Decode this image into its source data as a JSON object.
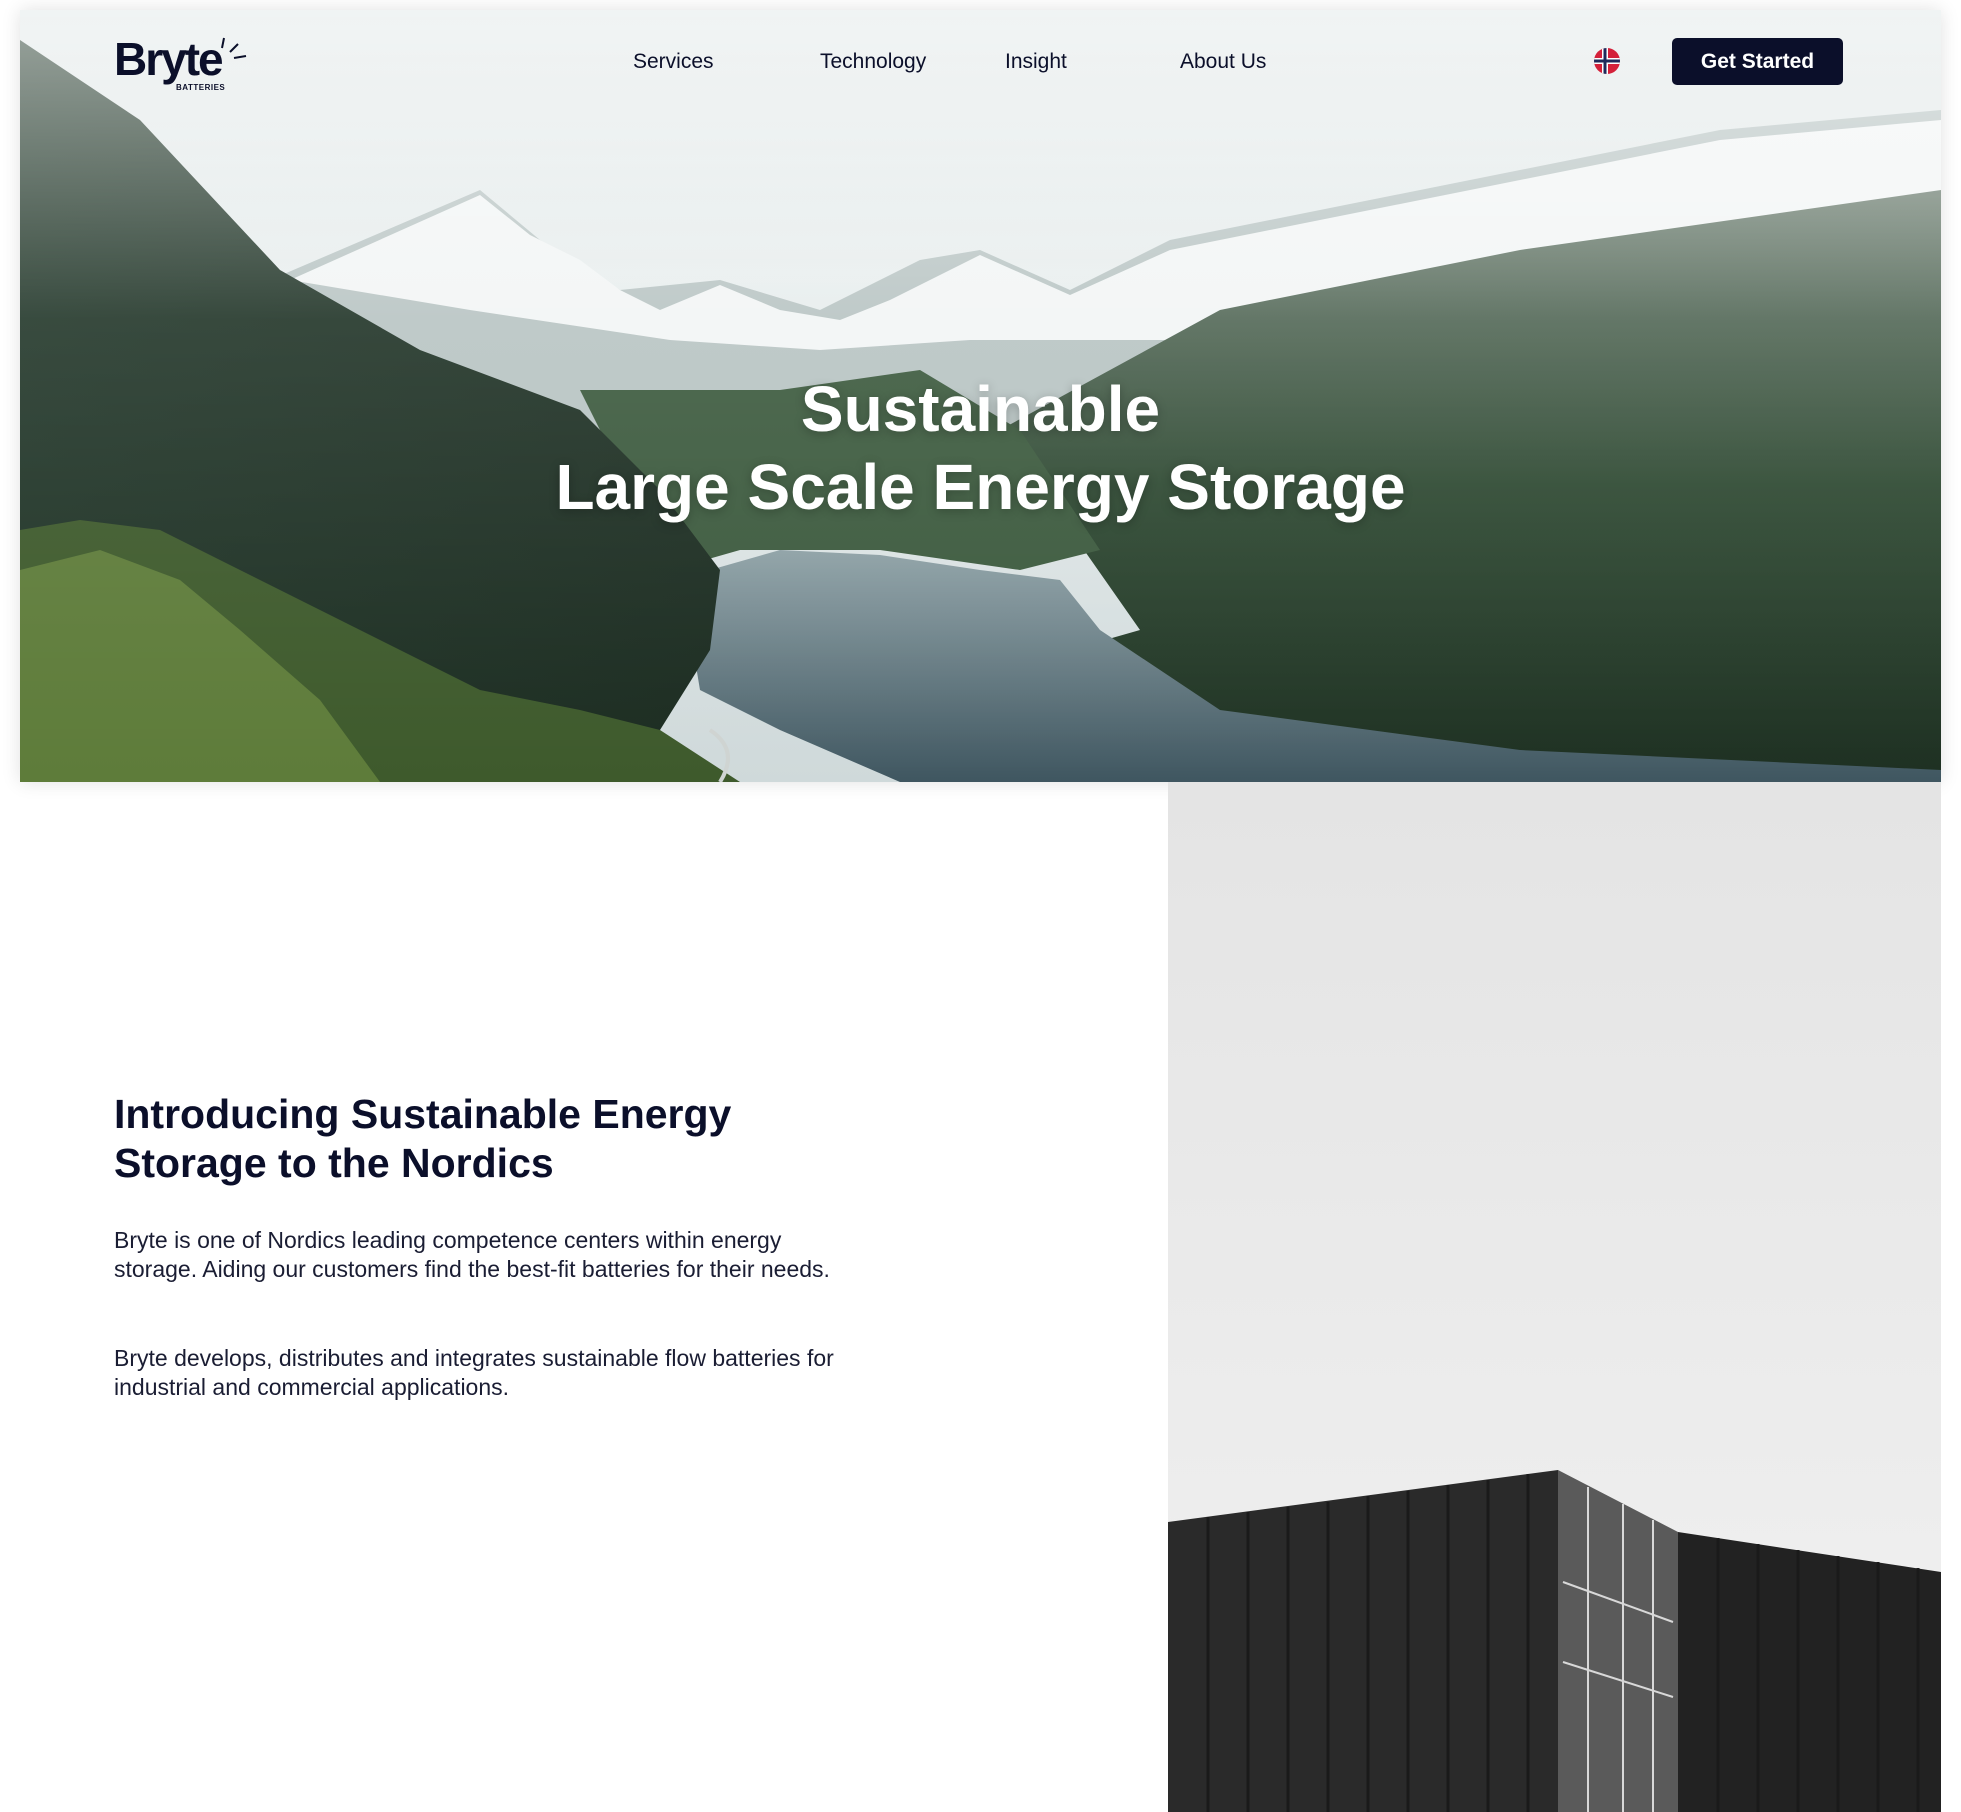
{
  "brand": {
    "name": "Bryte",
    "subtitle": "BATTERIES",
    "primary_color": "#0b0f2a"
  },
  "nav": {
    "items": [
      {
        "label": "Services"
      },
      {
        "label": "Technology"
      },
      {
        "label": "Insight"
      },
      {
        "label": "About Us"
      }
    ],
    "language_icon": "norway-flag-icon",
    "cta_label": "Get Started"
  },
  "hero": {
    "title_line1": "Sustainable",
    "title_line2": "Large Scale Energy Storage",
    "image": "fjord-mountains-photo"
  },
  "intro": {
    "heading_line1": "Introducing Sustainable Energy",
    "heading_line2": "Storage to the Nordics",
    "paragraph1": "Bryte is one of Nordics leading competence centers within energy storage. Aiding our customers find the best-fit batteries for their needs.",
    "paragraph2": "Bryte develops, distributes and integrates sustainable flow batteries for industrial and commercial applications.",
    "image": "shipping-container-photo"
  }
}
